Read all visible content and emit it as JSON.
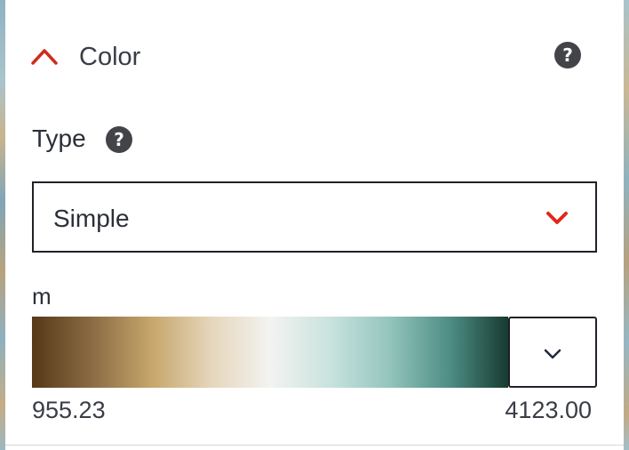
{
  "section": {
    "title": "Color",
    "expanded": true,
    "accent_color": "#cc2e1c",
    "help_icon": "question-circle-icon"
  },
  "type_field": {
    "label": "Type",
    "help_icon": "question-circle-icon",
    "selected_value": "Simple",
    "chevron_color": "#e0281b"
  },
  "color_ramp": {
    "unit": "m",
    "min_label": "955.23",
    "max_label": "4123.00",
    "stops": [
      "#553918",
      "#8c6d45",
      "#c6a66a",
      "#e6d7bd",
      "#f3f3f1",
      "#c7e2dd",
      "#94c5bd",
      "#4c8c83",
      "#173b30"
    ],
    "picker_icon": "chevron-down-icon"
  }
}
